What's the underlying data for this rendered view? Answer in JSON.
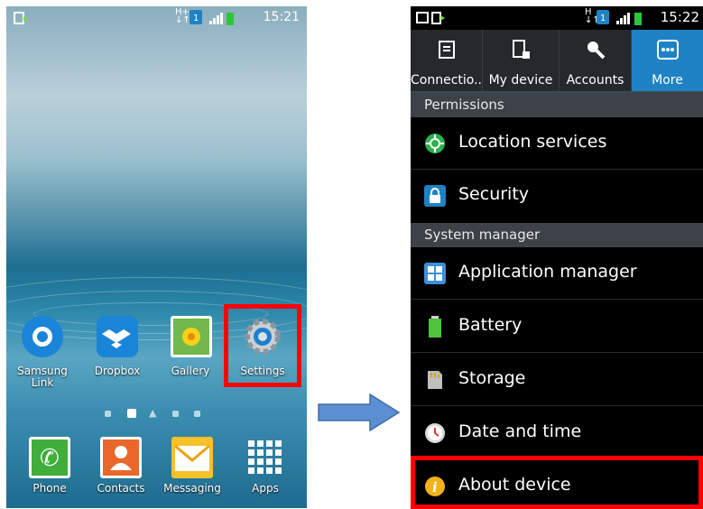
{
  "left_phone": {
    "status_time": "15:21",
    "apps_row1": [
      {
        "label": "Samsung\nLink",
        "icon": "samsung-link-icon"
      },
      {
        "label": "Dropbox",
        "icon": "dropbox-icon"
      },
      {
        "label": "Gallery",
        "icon": "gallery-icon"
      },
      {
        "label": "Settings",
        "icon": "gear-icon"
      }
    ],
    "dock": [
      {
        "label": "Phone",
        "icon": "phone-icon"
      },
      {
        "label": "Contacts",
        "icon": "contacts-icon"
      },
      {
        "label": "Messaging",
        "icon": "messaging-icon"
      },
      {
        "label": "Apps",
        "icon": "apps-grid-icon"
      }
    ],
    "highlight_color": "#ff0000"
  },
  "right_phone": {
    "status_time": "15:22",
    "tabs": [
      {
        "label": "Connectio..",
        "icon": "connections-icon"
      },
      {
        "label": "My device",
        "icon": "my-device-icon"
      },
      {
        "label": "Accounts",
        "icon": "accounts-icon"
      },
      {
        "label": "More",
        "icon": "more-icon",
        "selected": true
      }
    ],
    "sections": [
      {
        "title": "Permissions",
        "items": [
          {
            "label": "Location services",
            "icon": "location-icon"
          },
          {
            "label": "Security",
            "icon": "lock-icon"
          }
        ]
      },
      {
        "title": "System manager",
        "items": [
          {
            "label": "Application manager",
            "icon": "app-manager-icon"
          },
          {
            "label": "Battery",
            "icon": "battery-icon"
          },
          {
            "label": "Storage",
            "icon": "storage-icon"
          },
          {
            "label": "Date and time",
            "icon": "clock-icon"
          },
          {
            "label": "About device",
            "icon": "info-icon"
          }
        ]
      }
    ],
    "tab_selected_color": "#1f82c4"
  },
  "arrow_color": "#5b8fd2"
}
